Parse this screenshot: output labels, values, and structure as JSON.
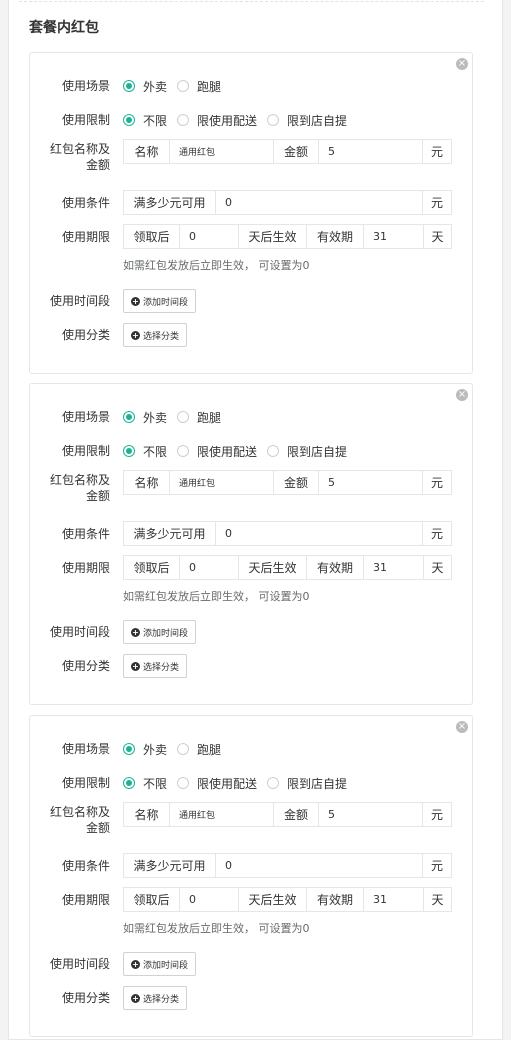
{
  "section_title": "套餐内红包",
  "labels": {
    "scene": "使用场景",
    "limit": "使用限制",
    "name_amount_line1": "红包名称及",
    "name_amount_line2": "金额",
    "condition": "使用条件",
    "period": "使用期限",
    "time_slot": "使用时间段",
    "category": "使用分类"
  },
  "options": {
    "scene": [
      "外卖",
      "跑腿"
    ],
    "limit": [
      "不限",
      "限使用配送",
      "限到店自提"
    ]
  },
  "addons": {
    "name": "名称",
    "amount": "金额",
    "yuan": "元",
    "min_spend": "满多少元可用",
    "receive_after": "领取后",
    "days_effective": "天后生效",
    "valid_period": "有效期",
    "day": "天"
  },
  "hint": "如需红包发放后立即生效， 可设置为0",
  "buttons": {
    "add_time_slot": "添加时间段",
    "select_category": "选择分类"
  },
  "icons": {
    "close": "close-circle-icon",
    "add": "plus-circle-icon"
  },
  "colors": {
    "accent": "#1ab394"
  },
  "cards": [
    {
      "scene_selected": 0,
      "limit_selected": 0,
      "name": "通用红包",
      "amount": "5",
      "min_spend": "0",
      "effective_after_days": "0",
      "valid_days": "31"
    },
    {
      "scene_selected": 0,
      "limit_selected": 0,
      "name": "通用红包",
      "amount": "5",
      "min_spend": "0",
      "effective_after_days": "0",
      "valid_days": "31"
    },
    {
      "scene_selected": 0,
      "limit_selected": 0,
      "name": "通用红包",
      "amount": "5",
      "min_spend": "0",
      "effective_after_days": "0",
      "valid_days": "31"
    }
  ]
}
